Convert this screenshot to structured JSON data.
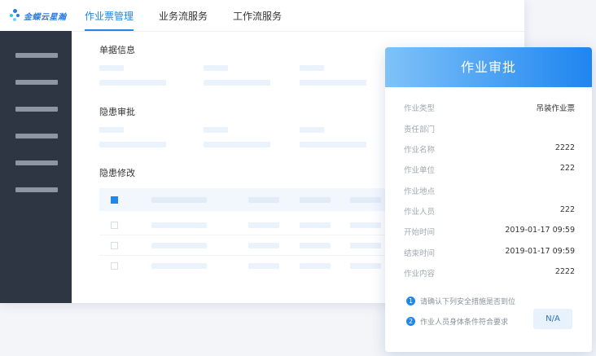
{
  "brand": {
    "name": "金蝶云星瀚",
    "accent": "#1f86ea",
    "sidebar_bg": "#2e3643"
  },
  "header": {
    "tabs": [
      {
        "label": "作业票管理",
        "active": true
      },
      {
        "label": "业务流服务",
        "active": false
      },
      {
        "label": "工作流服务",
        "active": false
      }
    ]
  },
  "main": {
    "sections": {
      "doc_info": "单据信息",
      "hazard_approval": "隐患审批",
      "hazard_edit": "隐患修改"
    },
    "table": {
      "header_checkbox_checked": true,
      "row_count": 3
    }
  },
  "card": {
    "title": "作业审批",
    "fields": [
      {
        "label": "作业类型",
        "value": "吊装作业票"
      },
      {
        "label": "责任部门",
        "value": ""
      },
      {
        "label": "作业名称",
        "value": "2222"
      },
      {
        "label": "作业单位",
        "value": "222"
      },
      {
        "label": "作业地点",
        "value": ""
      },
      {
        "label": "作业人员",
        "value": "222"
      },
      {
        "label": "开始时间",
        "value": "2019-01-17 09:59"
      },
      {
        "label": "结束时间",
        "value": "2019-01-17 09:59"
      },
      {
        "label": "作业内容",
        "value": "2222"
      }
    ],
    "checks": [
      {
        "num": "1",
        "text": "请确认下列安全措施是否到位"
      },
      {
        "num": "2",
        "text": "作业人员身体条件符合要求"
      }
    ],
    "na_label": "N/A"
  }
}
